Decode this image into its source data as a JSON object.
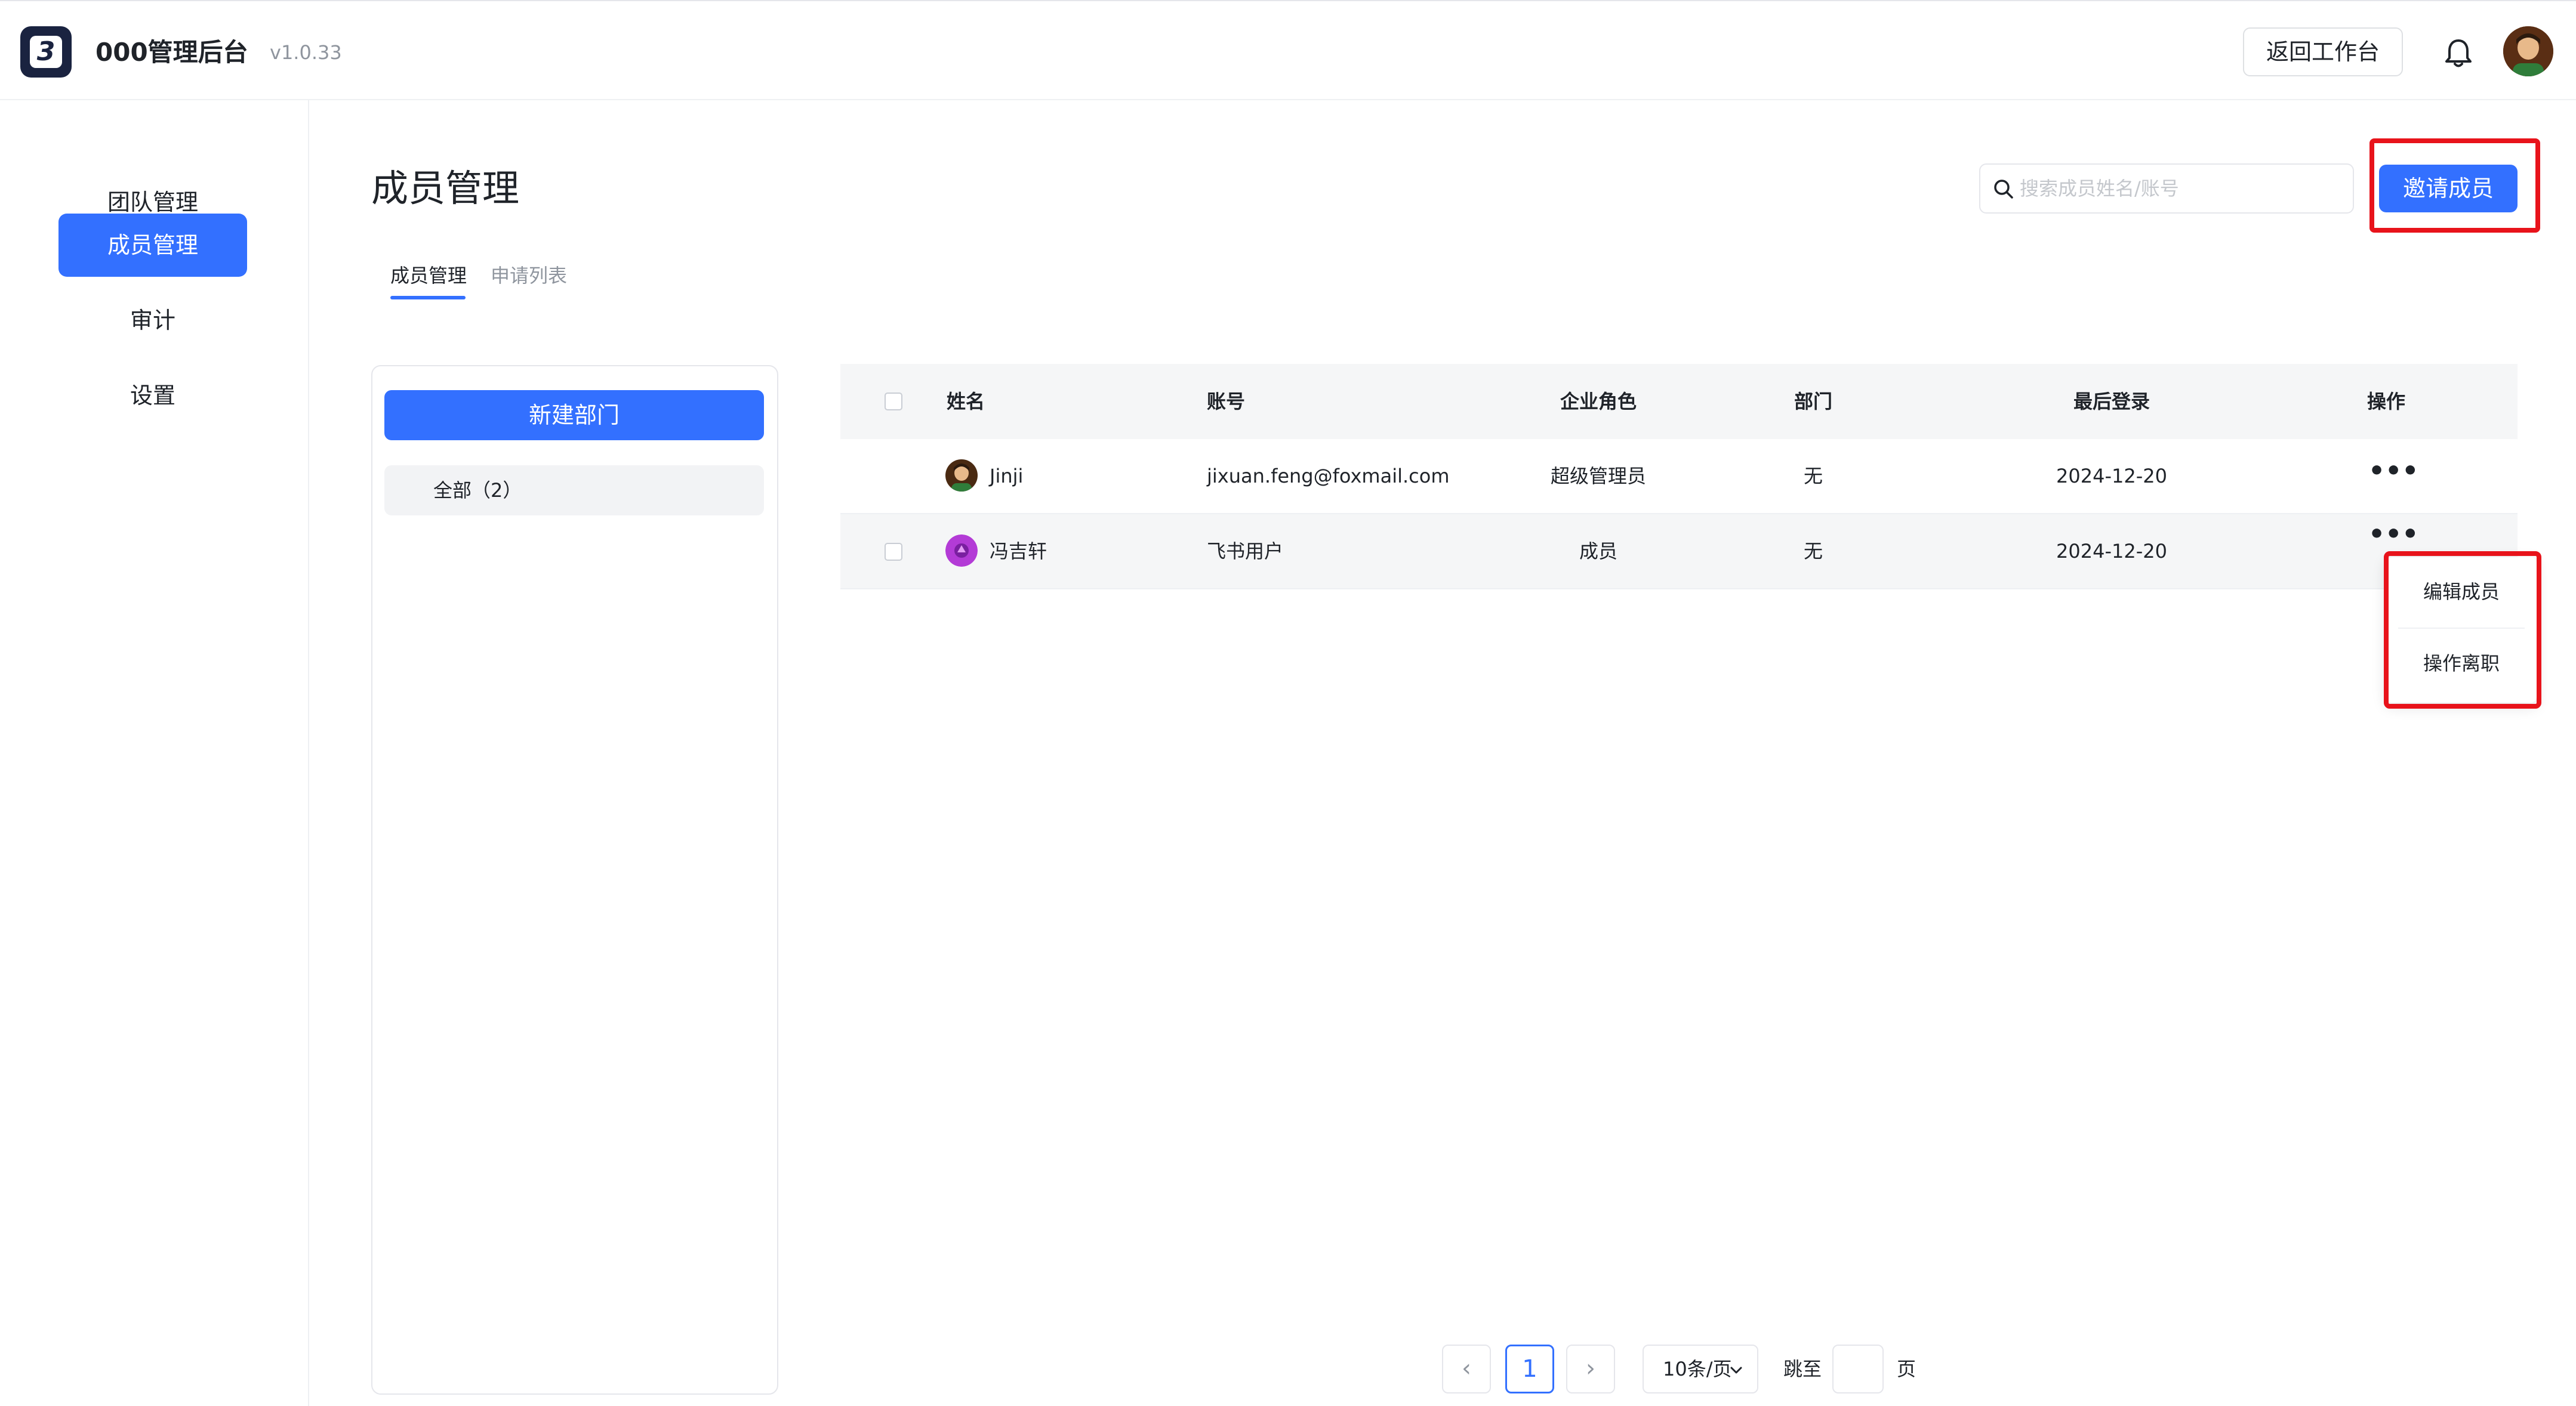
{
  "app": {
    "logo_text": "3",
    "title": "000管理后台",
    "version": "v1.0.33",
    "back_button": "返回工作台"
  },
  "sidebar": {
    "items": [
      {
        "label": "团队管理",
        "active": false
      },
      {
        "label": "成员管理",
        "active": true
      },
      {
        "label": "审计",
        "active": false
      },
      {
        "label": "设置",
        "active": false
      }
    ]
  },
  "main": {
    "title": "成员管理",
    "search_placeholder": "搜索成员姓名/账号",
    "invite_button": "邀请成员",
    "tabs": [
      {
        "label": "成员管理",
        "active": true
      },
      {
        "label": "申请列表",
        "active": false
      }
    ]
  },
  "departments": {
    "new_button": "新建部门",
    "all_label": "全部（2）"
  },
  "table": {
    "columns": [
      "姓名",
      "账号",
      "企业角色",
      "部门",
      "最后登录",
      "操作"
    ],
    "rows": [
      {
        "name": "Jinji",
        "account": "jixuan.feng@foxmail.com",
        "role": "超级管理员",
        "department": "无",
        "last_login": "2024-12-20",
        "more": "•••"
      },
      {
        "name": "冯吉轩",
        "account": "飞书用户",
        "role": "成员",
        "department": "无",
        "last_login": "2024-12-20",
        "more": "•••"
      }
    ]
  },
  "row_menu": {
    "items": [
      "编辑成员",
      "操作离职"
    ]
  },
  "pagination": {
    "prev": "‹",
    "next": "›",
    "current_page": "1",
    "page_size": "10条/页",
    "jump_label": "跳至",
    "page_suffix": "页"
  },
  "colors": {
    "primary": "#3370ff",
    "highlight": "#e8131b"
  },
  "icons": {
    "logo": "app-logo-icon",
    "bell": "bell-icon",
    "search": "search-icon",
    "more": "more-horizontal-icon",
    "chevron": "chevron-down-icon"
  }
}
